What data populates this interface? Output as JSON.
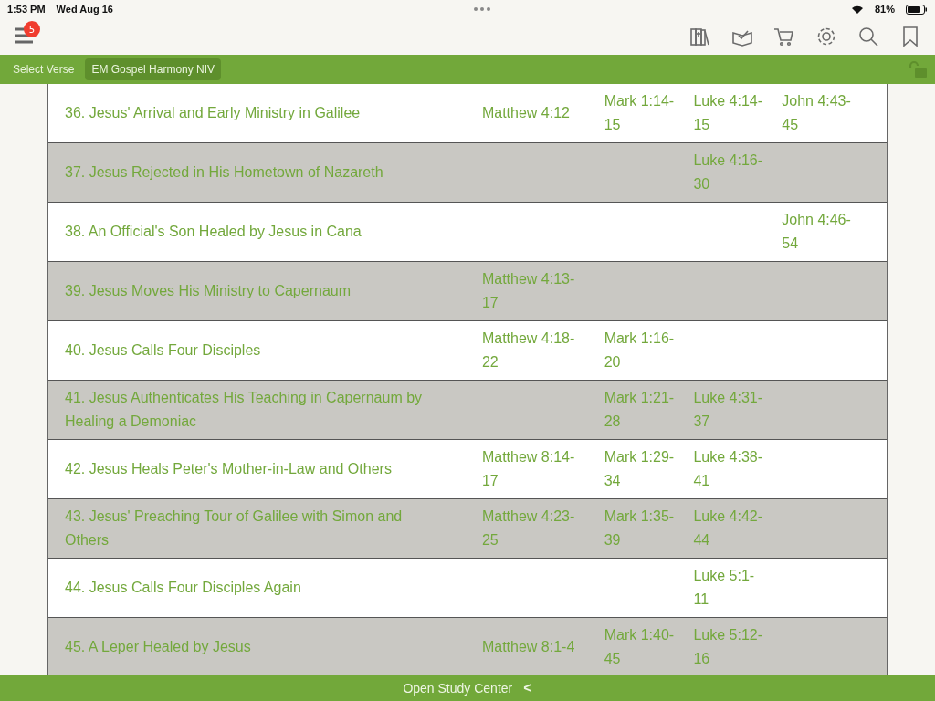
{
  "status_bar": {
    "time": "1:53 PM",
    "date": "Wed Aug 16",
    "battery": "81%"
  },
  "toolbar": {
    "menu_badge": "5"
  },
  "verse_bar": {
    "select_label": "Select Verse",
    "resource": "EM Gospel Harmony NIV"
  },
  "table": {
    "rows": [
      {
        "title": "36. Jesus' Arrival and Early Ministry in Galilee",
        "matthew": "Matthew 4:12",
        "mark": "Mark 1:14-15",
        "luke": "Luke 4:14-15",
        "john": "John 4:43-45"
      },
      {
        "title": "37. Jesus Rejected in His Hometown of Nazareth",
        "luke": "Luke 4:16-30"
      },
      {
        "title": "38. An Official's Son Healed by Jesus in Cana",
        "john": "John 4:46-54"
      },
      {
        "title": "39. Jesus Moves His Ministry to Capernaum",
        "matthew": "Matthew 4:13-17"
      },
      {
        "title": "40. Jesus Calls Four Disciples",
        "matthew": "Matthew 4:18-22",
        "mark": "Mark 1:16-20"
      },
      {
        "title": "41. Jesus Authenticates His Teaching in Capernaum by Healing a Demoniac",
        "mark": "Mark 1:21-28",
        "luke": "Luke 4:31-37"
      },
      {
        "title": "42. Jesus Heals Peter's Mother-in-Law and Others",
        "matthew": "Matthew 8:14-17",
        "mark": "Mark 1:29-34",
        "luke": "Luke 4:38-41"
      },
      {
        "title": "43. Jesus' Preaching Tour of Galilee with Simon and Others",
        "matthew": "Matthew 4:23-25",
        "mark": "Mark 1:35-39",
        "luke": "Luke 4:42-44"
      },
      {
        "title": "44. Jesus Calls Four Disciples Again",
        "luke": "Luke 5:1-11"
      },
      {
        "title": "45. A Leper Healed by Jesus",
        "matthew": "Matthew 8:1-4",
        "mark": "Mark 1:40-45",
        "luke": "Luke 5:12-16"
      }
    ]
  },
  "footer": {
    "label": "Open Study Center",
    "chevron": "<"
  }
}
